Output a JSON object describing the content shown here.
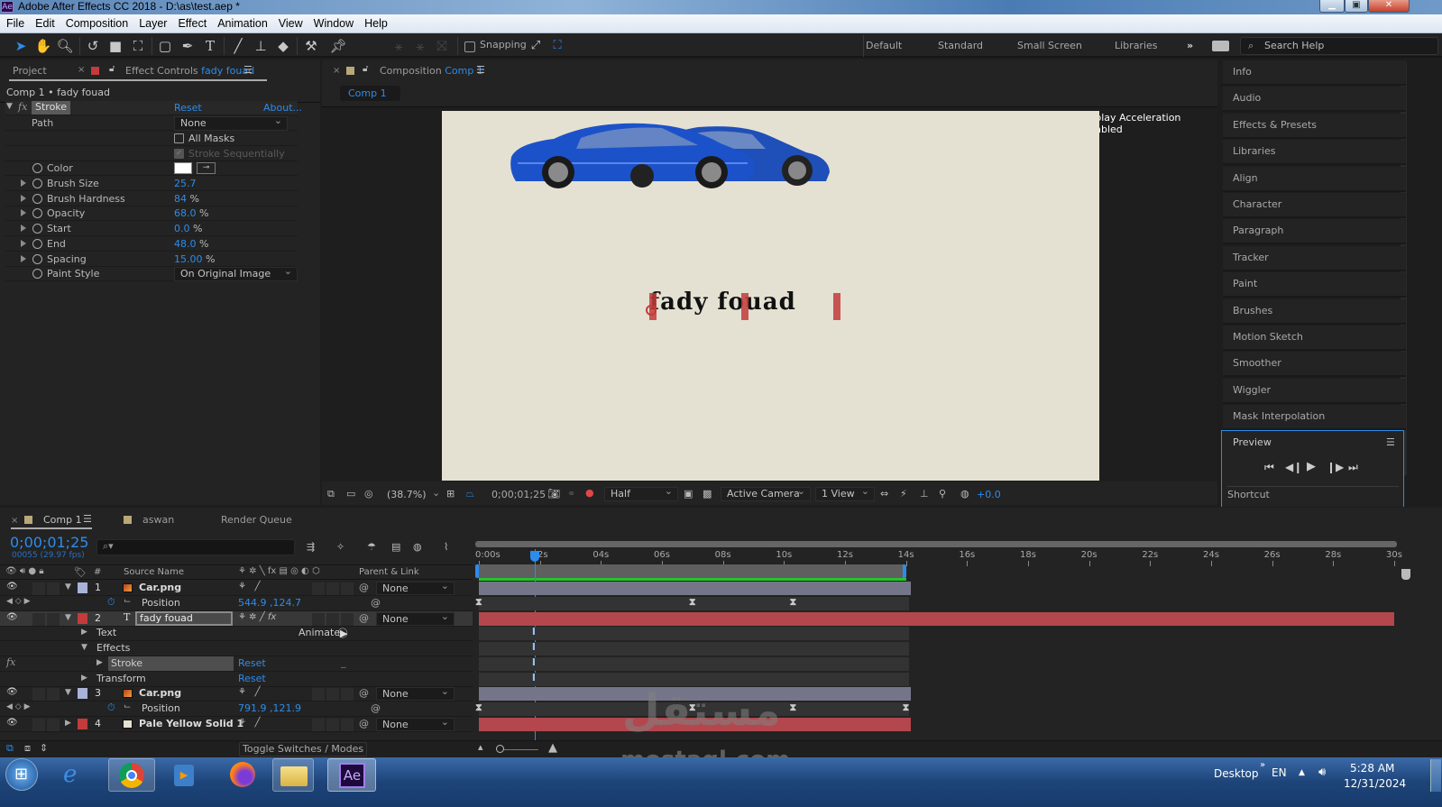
{
  "window": {
    "app_icon": "Ae",
    "title": "Adobe After Effects CC 2018 - D:\\as\\test.aep *",
    "controls": {
      "minimize": "minimize-icon",
      "maximize": "maximize-icon",
      "close": "close-icon"
    }
  },
  "menu": [
    "File",
    "Edit",
    "Composition",
    "Layer",
    "Effect",
    "Animation",
    "View",
    "Window",
    "Help"
  ],
  "toolbar": {
    "tools": [
      "selection-tool",
      "hand-tool",
      "zoom-tool",
      "rotation-tool",
      "camera-tool",
      "pan-behind-tool",
      "rectangle-tool",
      "pen-tool",
      "type-tool",
      "brush-tool",
      "clone-stamp-tool",
      "eraser-tool",
      "roto-brush-tool",
      "puppet-pin-tool"
    ],
    "snapping_label": "Snapping",
    "snapping_checked": false,
    "workspaces": [
      "Default",
      "Standard",
      "Small Screen",
      "Libraries"
    ],
    "more_label": "»",
    "search_placeholder": "Search Help"
  },
  "left_panel": {
    "tabs": {
      "project": "Project",
      "effect_controls": "Effect Controls",
      "effect_controls_layer": "fady fouad"
    },
    "breadcrumb": "Comp 1 • fady fouad",
    "effect": {
      "name": "Stroke",
      "reset": "Reset",
      "about": "About...",
      "path_label": "Path",
      "path_value": "None",
      "all_masks_label": "All Masks",
      "stroke_seq_label": "Stroke Sequentially",
      "color_label": "Color",
      "color_value": "#ffffff",
      "params": [
        {
          "label": "Brush Size",
          "value": "25.7",
          "unit": ""
        },
        {
          "label": "Brush Hardness",
          "value": "84",
          "unit": "%"
        },
        {
          "label": "Opacity",
          "value": "68.0",
          "unit": "%"
        },
        {
          "label": "Start",
          "value": "0.0",
          "unit": "%"
        },
        {
          "label": "End",
          "value": "48.0",
          "unit": "%"
        },
        {
          "label": "Spacing",
          "value": "15.00",
          "unit": "%"
        }
      ],
      "paint_style_label": "Paint Style",
      "paint_style_value": "On Original Image"
    }
  },
  "comp_panel": {
    "tab_label": "Composition",
    "tab_comp": "Comp 1",
    "subtab": "Comp 1",
    "notice": "Display Acceleration Disabled",
    "canvas_text": "fady fouad",
    "canvas_bg": "#e5e1d2",
    "footer": {
      "zoom": "(38.7%)",
      "timecode": "0;00;01;25",
      "resolution": "Half",
      "camera": "Active Camera",
      "views": "1 View",
      "exposure": "+0.0"
    }
  },
  "right_panel": {
    "items": [
      "Info",
      "Audio",
      "Effects & Presets",
      "Libraries",
      "Align",
      "Character",
      "Paragraph",
      "Tracker",
      "Paint",
      "Brushes",
      "Motion Sketch",
      "Smoother",
      "Wiggler",
      "Mask Interpolation"
    ],
    "preview": {
      "title": "Preview",
      "shortcut_label": "Shortcut"
    }
  },
  "timeline": {
    "tabs": [
      {
        "label": "Comp 1",
        "active": true
      },
      {
        "label": "aswan",
        "active": false
      },
      {
        "label": "Render Queue",
        "active": false
      }
    ],
    "timecode": "0;00;01;25",
    "frame_info": "00055 (29.97 fps)",
    "search_placeholder": "",
    "columns": {
      "num": "#",
      "source": "Source Name",
      "parent": "Parent & Link"
    },
    "ruler": [
      "0:00s",
      "02s",
      "04s",
      "06s",
      "08s",
      "10s",
      "12s",
      "14s",
      "16s",
      "18s",
      "20s",
      "22s",
      "24s",
      "26s",
      "28s",
      "30s"
    ],
    "playhead_seconds": 1.83,
    "work_area_end_seconds": 14,
    "duration_seconds": 30,
    "rows": [
      {
        "type": "layer",
        "num": "1",
        "name": "Car.png",
        "label_color": "#a9b3d9",
        "parent": "None",
        "icon": "image-icon"
      },
      {
        "type": "prop",
        "name": "Position",
        "value": "544.9 ,124.7"
      },
      {
        "type": "layer",
        "num": "2",
        "name": "fady fouad",
        "label_color": "#c33b3b",
        "parent": "None",
        "icon": "text-layer-icon",
        "selected": true
      },
      {
        "type": "group",
        "name": "Text",
        "animate_label": "Animate:"
      },
      {
        "type": "group",
        "name": "Effects"
      },
      {
        "type": "effect",
        "name": "Stroke",
        "reset": "Reset"
      },
      {
        "type": "group",
        "name": "Transform",
        "reset": "Reset"
      },
      {
        "type": "layer",
        "num": "3",
        "name": "Car.png",
        "label_color": "#a9b3d9",
        "parent": "None",
        "icon": "image-icon"
      },
      {
        "type": "prop",
        "name": "Position",
        "value": "791.9 ,121.9"
      },
      {
        "type": "layer",
        "num": "4",
        "name": "Pale Yellow Solid 1",
        "label_color": "#c33b3b",
        "parent": "None",
        "icon": "solid-icon"
      }
    ],
    "keyframes_row1_seconds": [
      0,
      7,
      10.3
    ],
    "keyframes_row3_seconds": [
      0,
      7,
      10.3,
      14
    ],
    "toggle_label": "Toggle Switches / Modes"
  },
  "taskbar": {
    "apps": [
      "windows-start",
      "internet-explorer",
      "chrome",
      "media-player",
      "firefox",
      "file-explorer",
      "after-effects"
    ],
    "desktop_label": "Desktop",
    "lang": "EN",
    "time": "5:28 AM",
    "date": "12/31/2024"
  },
  "watermark": {
    "arabic": "مستقل",
    "latin": "mostaql.com"
  }
}
